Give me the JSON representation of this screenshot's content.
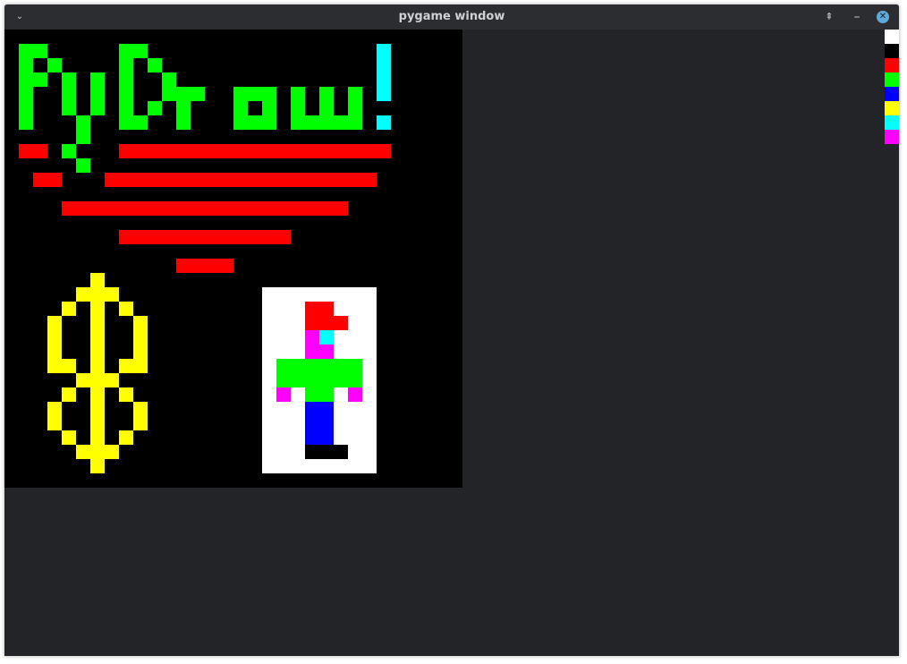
{
  "window": {
    "title": "pygame window",
    "menu_glyph": "⌄",
    "keep_above_glyph": "⇞",
    "minimize_glyph": "–",
    "close_glyph": "✕"
  },
  "canvas": {
    "background": "#000000",
    "artwork": "PyDraw! pixel art: green 'PyDraw' text with a cyan exclamation mark, red horizontal stripes forming a triangle, a yellow dollar sign, and a pixel character on a white card"
  },
  "palette": {
    "colors": [
      {
        "name": "white",
        "hex": "#ffffff"
      },
      {
        "name": "black",
        "hex": "#000000"
      },
      {
        "name": "red",
        "hex": "#ff0000"
      },
      {
        "name": "green",
        "hex": "#00ff00"
      },
      {
        "name": "blue",
        "hex": "#0000ff"
      },
      {
        "name": "yellow",
        "hex": "#ffff00"
      },
      {
        "name": "cyan",
        "hex": "#00ffff"
      },
      {
        "name": "magenta",
        "hex": "#ff00ff"
      }
    ]
  }
}
